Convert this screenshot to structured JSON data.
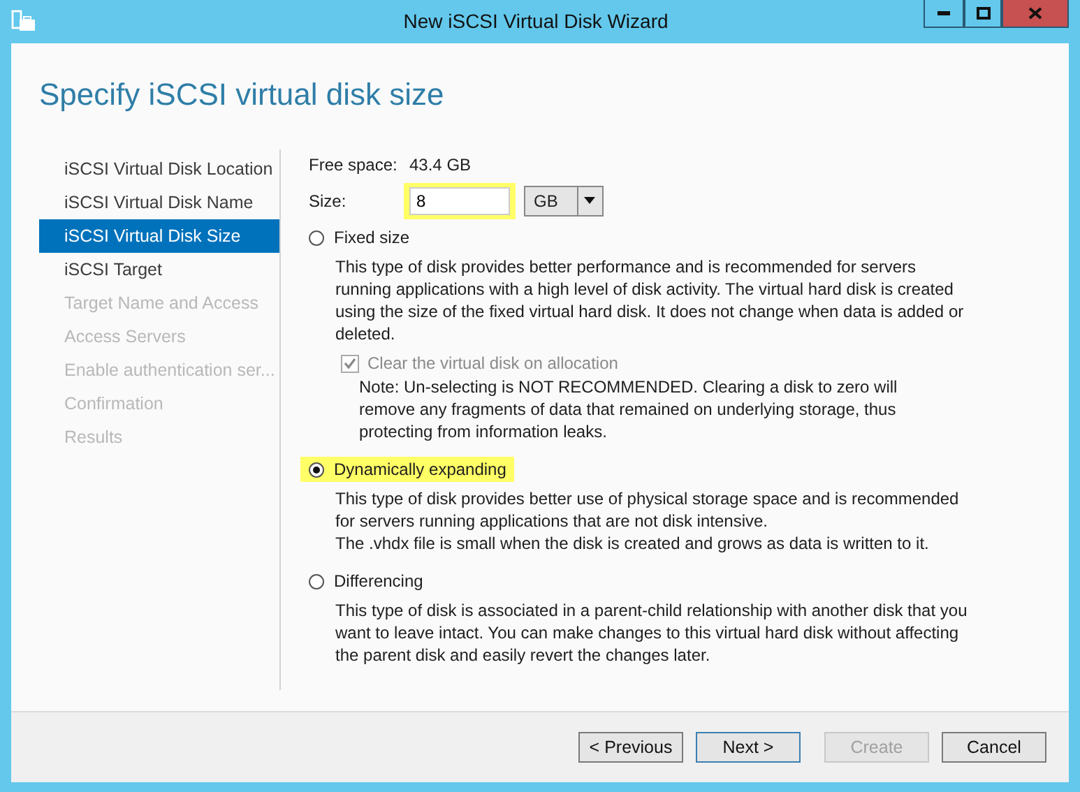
{
  "window": {
    "title": "New iSCSI Virtual Disk Wizard"
  },
  "heading": "Specify iSCSI virtual disk size",
  "steps": [
    {
      "label": "iSCSI Virtual Disk Location",
      "selected": false,
      "disabled": false
    },
    {
      "label": "iSCSI Virtual Disk Name",
      "selected": false,
      "disabled": false
    },
    {
      "label": "iSCSI Virtual Disk Size",
      "selected": true,
      "disabled": false
    },
    {
      "label": "iSCSI Target",
      "selected": false,
      "disabled": false
    },
    {
      "label": "Target Name and Access",
      "selected": false,
      "disabled": true
    },
    {
      "label": "Access Servers",
      "selected": false,
      "disabled": true
    },
    {
      "label": "Enable authentication ser...",
      "selected": false,
      "disabled": true
    },
    {
      "label": "Confirmation",
      "selected": false,
      "disabled": true
    },
    {
      "label": "Results",
      "selected": false,
      "disabled": true
    }
  ],
  "free_space": {
    "label": "Free space:",
    "value": "43.4 GB"
  },
  "size": {
    "label": "Size:",
    "value": "8",
    "highlighted": true,
    "unit": "GB"
  },
  "options": [
    {
      "label": "Fixed size",
      "selected": false,
      "highlighted": false,
      "description": "This type of disk provides better performance and is recommended for servers running applications with a high level of disk activity. The virtual hard disk is created using the size of the fixed virtual hard disk. It does not change when data is added or deleted.",
      "checkbox": {
        "label": "Clear the virtual disk on allocation",
        "checked": true,
        "disabled": true
      },
      "note": "Note: Un-selecting is NOT RECOMMENDED. Clearing a disk to zero will remove any fragments of data that remained on underlying storage, thus protecting from information leaks."
    },
    {
      "label": "Dynamically expanding",
      "selected": true,
      "highlighted": true,
      "description": "This type of disk provides better use of physical storage space and is recommended for servers running applications that are not disk intensive.\nThe .vhdx file is small when the disk is created and grows as data is written to it."
    },
    {
      "label": "Differencing",
      "selected": false,
      "highlighted": false,
      "description": "This type of disk is associated in a parent-child relationship with another disk that you want to leave intact. You can make changes to this virtual hard disk without affecting the parent disk and easily revert the changes later."
    }
  ],
  "buttons": [
    {
      "label": "< Previous",
      "disabled": false,
      "focused": false
    },
    {
      "label": "Next >",
      "disabled": false,
      "focused": true
    },
    {
      "label": "Create",
      "disabled": true,
      "focused": false
    },
    {
      "label": "Cancel",
      "disabled": false,
      "focused": false
    }
  ]
}
